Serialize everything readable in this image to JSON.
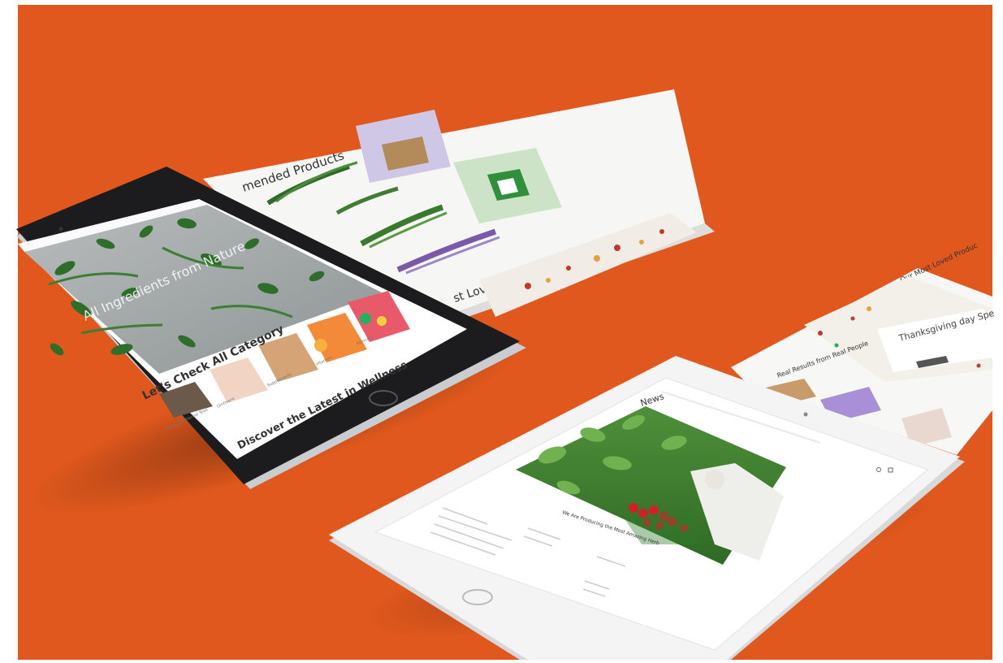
{
  "colors": {
    "background": "#E0581D",
    "frame": "#FFFFFF",
    "tablet_dark": "#1C1C1E",
    "tablet_light": "#F4F4F4"
  },
  "dark_tablet": {
    "hero_text": "All Ingredients from Nature",
    "category_heading": "Let's Check All Category",
    "wellness_heading": "Discover the Latest in Wellness",
    "category_labels": [
      "Traditional Herbal Teas",
      "Ointment",
      "Supplements",
      "Vitamins",
      "Skincare"
    ]
  },
  "back_sheet": {
    "heading_recommended": "mended Products",
    "heading_loved": "st Loved Products"
  },
  "right_sheet": {
    "heading_loved": "Our Most Loved Produc",
    "banner_text": "Thanksgiving day Spe",
    "heading_results": "Real Results from Real People"
  },
  "light_tablet": {
    "page_title": "News",
    "article_title": "We Are Producing the Most Amazing Herb"
  }
}
